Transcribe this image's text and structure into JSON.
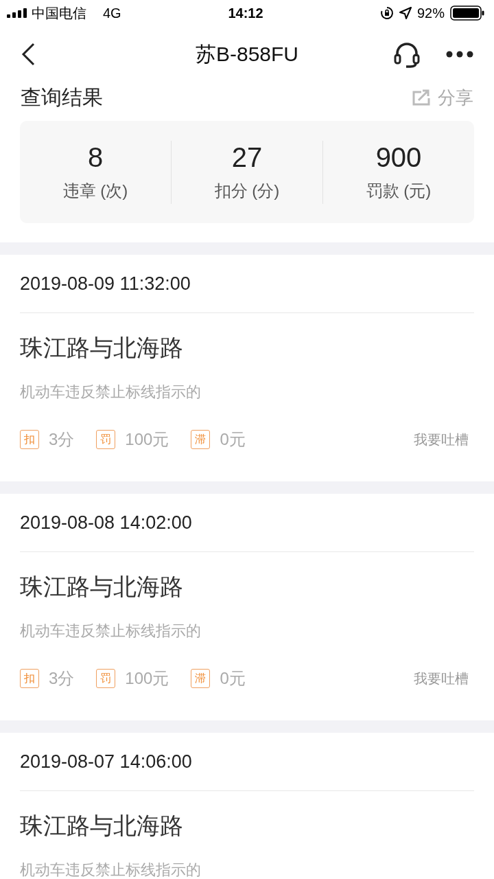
{
  "status_bar": {
    "carrier": "中国电信",
    "network": "4G",
    "time": "14:12",
    "battery": "92%"
  },
  "nav": {
    "title": "苏B-858FU"
  },
  "header": {
    "title": "查询结果",
    "share": "分享"
  },
  "summary": [
    {
      "value": "8",
      "label": "违章 (次)"
    },
    {
      "value": "27",
      "label": "扣分 (分)"
    },
    {
      "value": "900",
      "label": "罚款 (元)"
    }
  ],
  "records": [
    {
      "date": "2019-08-09 11:32:00",
      "location": "珠江路与北海路",
      "violation": "机动车违反禁止标线指示的",
      "fees": [
        {
          "tag": "扣",
          "amount": "3分"
        },
        {
          "tag": "罚",
          "amount": "100元"
        },
        {
          "tag": "滞",
          "amount": "0元"
        }
      ],
      "feedback": "我要吐槽"
    },
    {
      "date": "2019-08-08 14:02:00",
      "location": "珠江路与北海路",
      "violation": "机动车违反禁止标线指示的",
      "fees": [
        {
          "tag": "扣",
          "amount": "3分"
        },
        {
          "tag": "罚",
          "amount": "100元"
        },
        {
          "tag": "滞",
          "amount": "0元"
        }
      ],
      "feedback": "我要吐槽"
    },
    {
      "date": "2019-08-07 14:06:00",
      "location": "珠江路与北海路",
      "violation": "机动车违反禁止标线指示的"
    }
  ]
}
